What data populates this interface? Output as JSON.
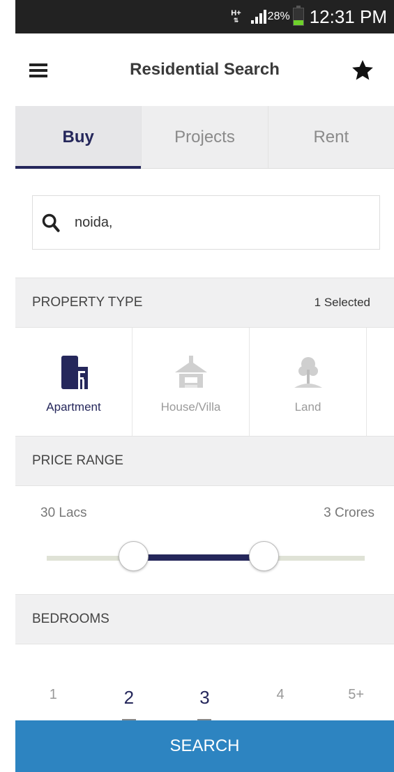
{
  "status_bar": {
    "network": "H+",
    "battery_percent": "28%",
    "battery_level": 0.28,
    "time": "12:31 PM"
  },
  "header": {
    "title": "Residential Search",
    "menu_icon": "hamburger-menu-icon",
    "favorite_icon": "star-icon"
  },
  "tabs": [
    {
      "label": "Buy",
      "active": true
    },
    {
      "label": "Projects",
      "active": false
    },
    {
      "label": "Rent",
      "active": false
    }
  ],
  "search": {
    "icon": "search-icon",
    "value": "noida,"
  },
  "property_type": {
    "heading": "PROPERTY TYPE",
    "selected_count": "1 Selected",
    "items": [
      {
        "label": "Apartment",
        "icon": "apartment-icon",
        "selected": true
      },
      {
        "label": "House/Villa",
        "icon": "house-icon",
        "selected": false
      },
      {
        "label": "Land",
        "icon": "land-tree-icon",
        "selected": false
      }
    ]
  },
  "price_range": {
    "heading": "PRICE RANGE",
    "min_label": "30 Lacs",
    "max_label": "3 Crores"
  },
  "bedrooms": {
    "heading": "BEDROOMS",
    "options": [
      {
        "label": "1",
        "selected": false
      },
      {
        "label": "2",
        "selected": true
      },
      {
        "label": "3",
        "selected": true
      },
      {
        "label": "4",
        "selected": false
      },
      {
        "label": "5+",
        "selected": false
      }
    ]
  },
  "search_button": {
    "label": "SEARCH"
  },
  "colors": {
    "accent": "#25275b",
    "button": "#2d84c1",
    "status_bar": "#222222",
    "tab_bg": "#eeeeef"
  }
}
